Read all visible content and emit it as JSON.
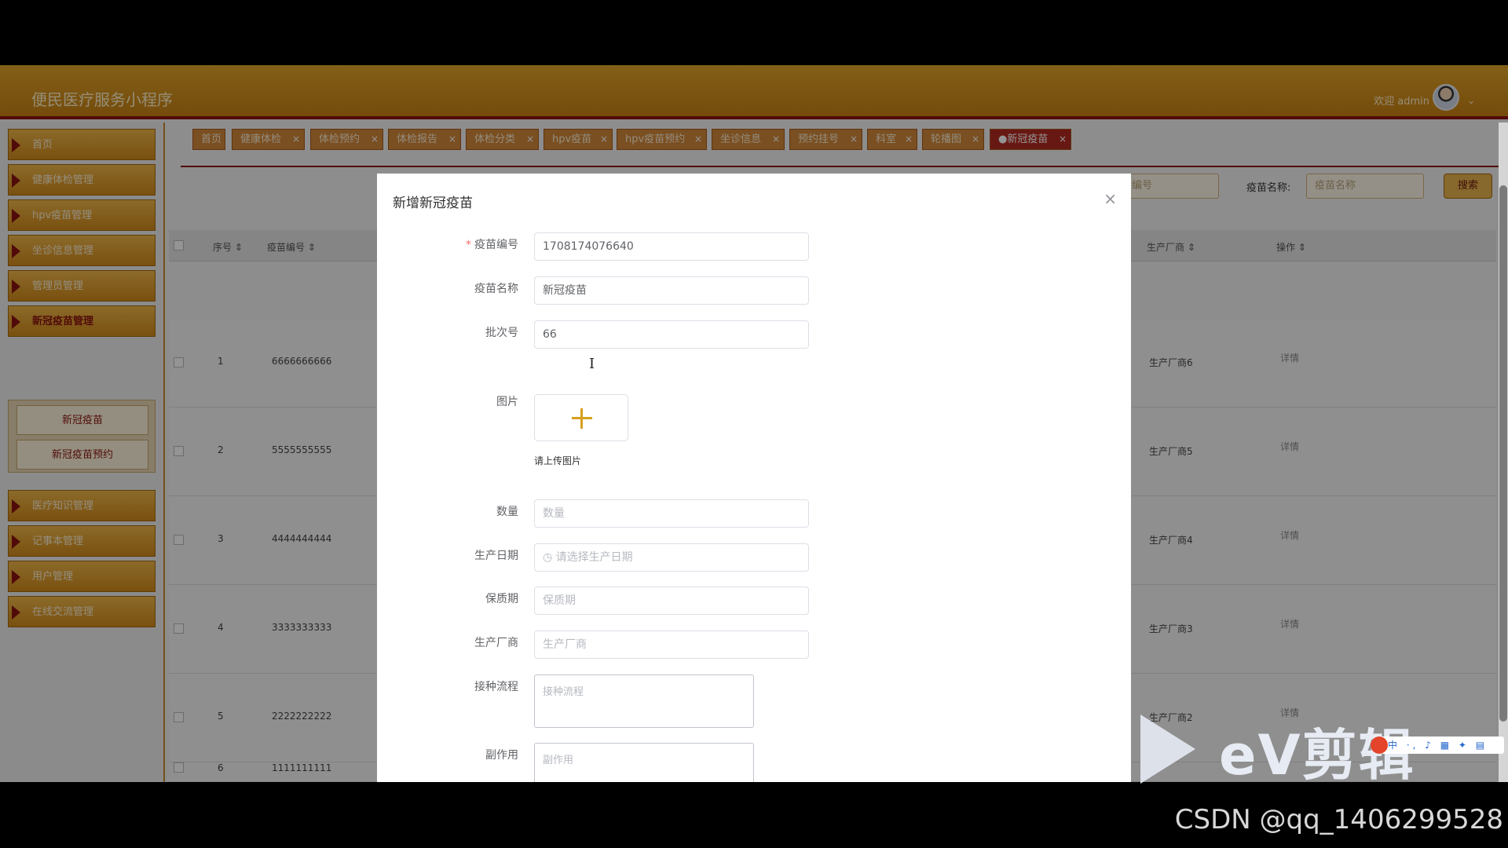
{
  "app": {
    "title": "便民医疗服务小程序",
    "welcome": "欢迎 admin",
    "caret": "⌄"
  },
  "sidebar": {
    "items": [
      {
        "label": "首页"
      },
      {
        "label": "健康体检管理"
      },
      {
        "label": "hpv疫苗管理"
      },
      {
        "label": "坐诊信息管理"
      },
      {
        "label": "管理员管理"
      },
      {
        "label": "新冠疫苗管理"
      },
      {
        "label": "医疗知识管理"
      },
      {
        "label": "记事本管理"
      },
      {
        "label": "用户管理"
      },
      {
        "label": "在线交流管理"
      }
    ],
    "submenu": [
      {
        "label": "新冠疫苗"
      },
      {
        "label": "新冠疫苗预约"
      }
    ]
  },
  "tabs": [
    {
      "label": "首页"
    },
    {
      "label": "健康体检"
    },
    {
      "label": "体检预约"
    },
    {
      "label": "体检报告"
    },
    {
      "label": "体检分类"
    },
    {
      "label": "hpv疫苗"
    },
    {
      "label": "hpv疫苗预约"
    },
    {
      "label": "坐诊信息"
    },
    {
      "label": "预约挂号"
    },
    {
      "label": "科室"
    },
    {
      "label": "轮播图"
    },
    {
      "label": "●新冠疫苗"
    }
  ],
  "search": {
    "code_placeholder": "编号",
    "name_label": "疫苗名称:",
    "name_placeholder": "疫苗名称",
    "button": "搜索"
  },
  "table": {
    "headers": {
      "index": "序号 ⇕",
      "code": "疫苗编号 ⇕",
      "maker": "生产厂商 ⇕",
      "op": "操作 ⇕"
    },
    "rows": [
      {
        "index": "1",
        "code": "6666666666",
        "maker": "生产厂商6",
        "op": "详情"
      },
      {
        "index": "2",
        "code": "5555555555",
        "maker": "生产厂商5",
        "op": "详情"
      },
      {
        "index": "3",
        "code": "4444444444",
        "maker": "生产厂商4",
        "op": "详情"
      },
      {
        "index": "4",
        "code": "3333333333",
        "maker": "生产厂商3",
        "op": "详情"
      },
      {
        "index": "5",
        "code": "2222222222",
        "maker": "生产厂商2",
        "op": "详情"
      },
      {
        "index": "6",
        "code": "1111111111",
        "maker": "",
        "op": ""
      }
    ]
  },
  "modal": {
    "title": "新增新冠疫苗",
    "close": "×",
    "required_mark": "*",
    "fields": {
      "code": {
        "label": "疫苗编号",
        "value": "1708174076640"
      },
      "name": {
        "label": "疫苗名称",
        "value": "新冠疫苗"
      },
      "batch": {
        "label": "批次号",
        "value": "66"
      },
      "image": {
        "label": "图片",
        "hint": "请上传图片"
      },
      "quantity": {
        "label": "数量",
        "placeholder": "数量"
      },
      "date": {
        "label": "生产日期",
        "placeholder": "◷  请选择生产日期"
      },
      "shelf": {
        "label": "保质期",
        "placeholder": "保质期"
      },
      "maker": {
        "label": "生产厂商",
        "placeholder": "生产厂商"
      },
      "process": {
        "label": "接种流程",
        "placeholder": "接种流程"
      },
      "side": {
        "label": "副作用",
        "placeholder": "副作用"
      }
    }
  },
  "overlay": {
    "ev_logo": "eV剪辑",
    "ime": "中 ·, ♪ ▦ ✦ ▤",
    "csdn": "CSDN @qq_1406299528"
  },
  "colors": {
    "brand_gold": "#e2a52a",
    "brand_red": "#8b1410",
    "accent": "#d7a01d"
  }
}
